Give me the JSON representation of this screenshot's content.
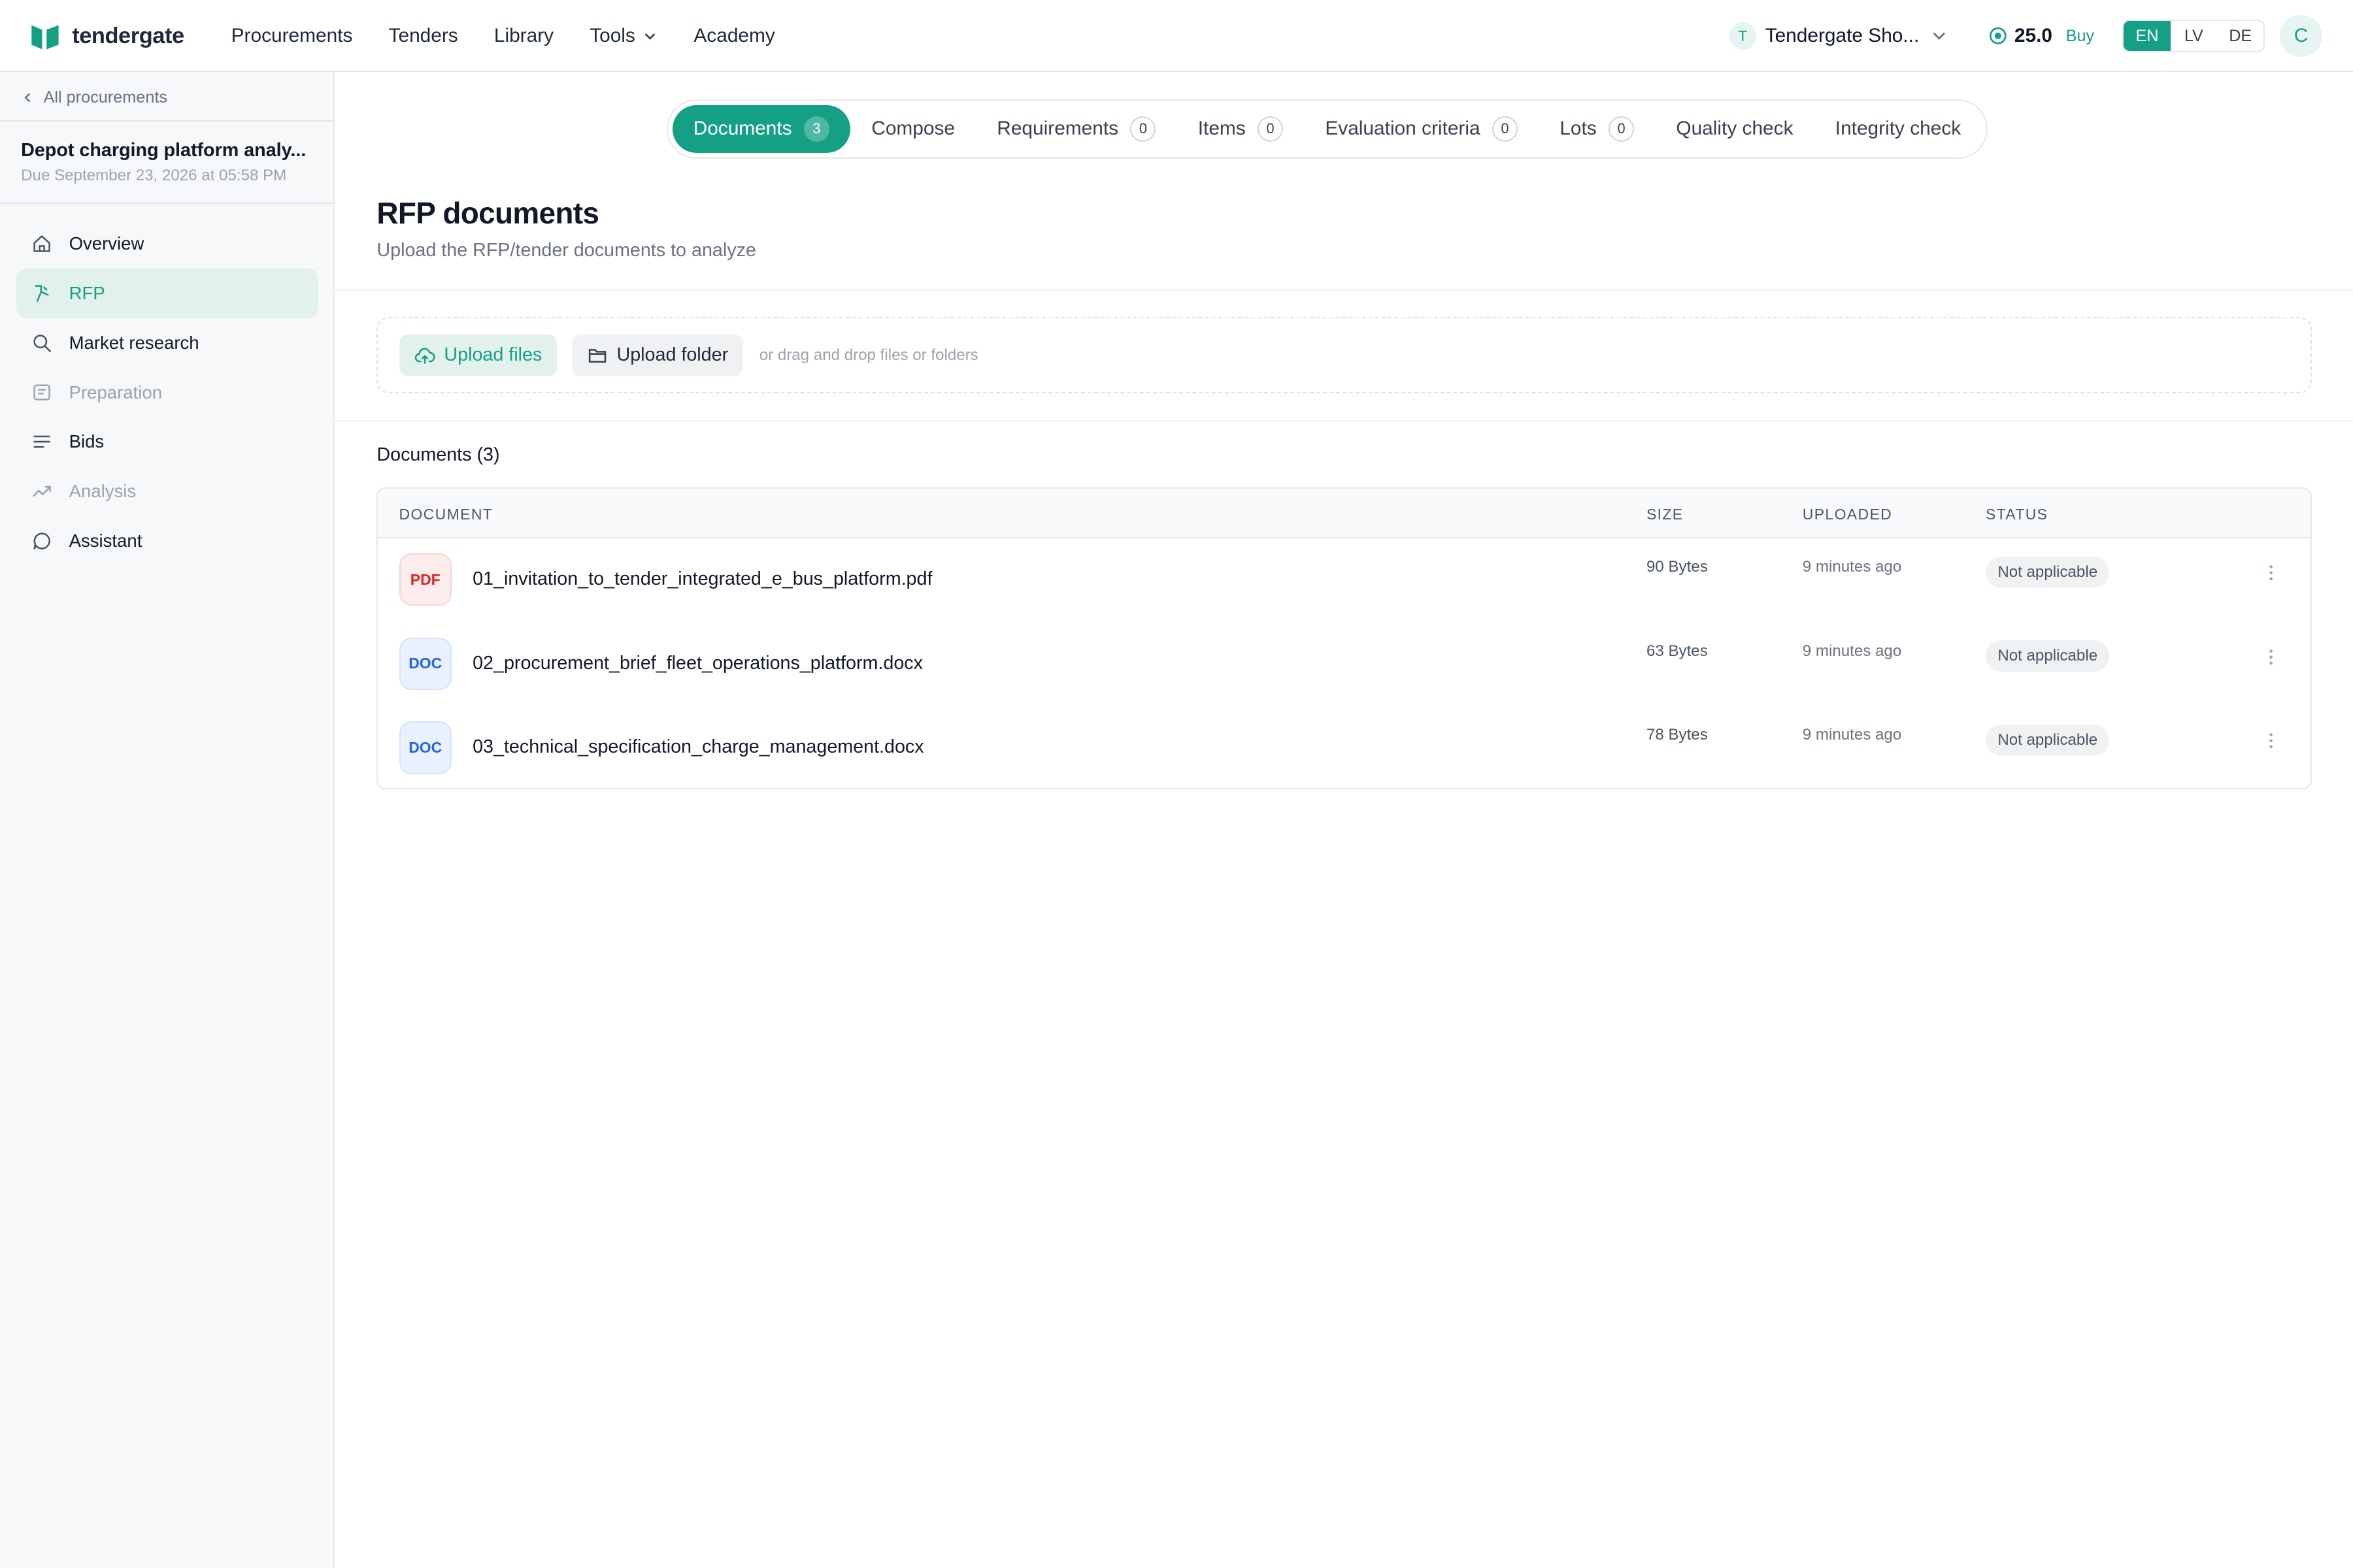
{
  "brand": {
    "name": "tendergate",
    "accent": "#14a085"
  },
  "topnav": {
    "items": [
      {
        "label": "Procurements"
      },
      {
        "label": "Tenders"
      },
      {
        "label": "Library"
      },
      {
        "label": "Tools",
        "icon": "chevron-down-icon"
      },
      {
        "label": "Academy"
      }
    ]
  },
  "org": {
    "initial": "T",
    "name": "Tendergate Sho..."
  },
  "credits": {
    "value": "25.0",
    "buy_label": "Buy"
  },
  "languages": {
    "options": [
      "EN",
      "LV",
      "DE"
    ],
    "selected": "EN"
  },
  "user": {
    "initial": "C"
  },
  "sidebar": {
    "back_label": "All procurements",
    "procurement_title": "Depot charging platform analy...",
    "procurement_due": "Due September 23, 2026 at 05:58 PM",
    "items": [
      {
        "label": "Overview",
        "icon": "home-icon",
        "state": "normal"
      },
      {
        "label": "RFP",
        "icon": "rfp-icon",
        "state": "active"
      },
      {
        "label": "Market research",
        "icon": "search-icon",
        "state": "normal"
      },
      {
        "label": "Preparation",
        "icon": "clipboard-icon",
        "state": "muted"
      },
      {
        "label": "Bids",
        "icon": "list-icon",
        "state": "normal"
      },
      {
        "label": "Analysis",
        "icon": "trend-icon",
        "state": "muted"
      },
      {
        "label": "Assistant",
        "icon": "chat-icon",
        "state": "normal"
      }
    ]
  },
  "tabs": [
    {
      "label": "Documents",
      "count": "3",
      "active": true
    },
    {
      "label": "Compose"
    },
    {
      "label": "Requirements",
      "count": "0"
    },
    {
      "label": "Items",
      "count": "0"
    },
    {
      "label": "Evaluation criteria",
      "count": "0"
    },
    {
      "label": "Lots",
      "count": "0"
    },
    {
      "label": "Quality check"
    },
    {
      "label": "Integrity check"
    }
  ],
  "page": {
    "title": "RFP documents",
    "subtitle": "Upload the RFP/tender documents to analyze"
  },
  "upload": {
    "files_label": "Upload files",
    "folder_label": "Upload folder",
    "hint": "or drag and drop files or folders"
  },
  "documents": {
    "heading": "Documents (3)",
    "columns": {
      "document": "DOCUMENT",
      "size": "SIZE",
      "uploaded": "UPLOADED",
      "status": "STATUS"
    },
    "rows": [
      {
        "type": "PDF",
        "name": "01_invitation_to_tender_integrated_e_bus_platform.pdf",
        "size": "90 Bytes",
        "uploaded": "9 minutes ago",
        "status": "Not applicable"
      },
      {
        "type": "DOC",
        "name": "02_procurement_brief_fleet_operations_platform.docx",
        "size": "63 Bytes",
        "uploaded": "9 minutes ago",
        "status": "Not applicable"
      },
      {
        "type": "DOC",
        "name": "03_technical_specification_charge_management.docx",
        "size": "78 Bytes",
        "uploaded": "9 minutes ago",
        "status": "Not applicable"
      }
    ]
  }
}
